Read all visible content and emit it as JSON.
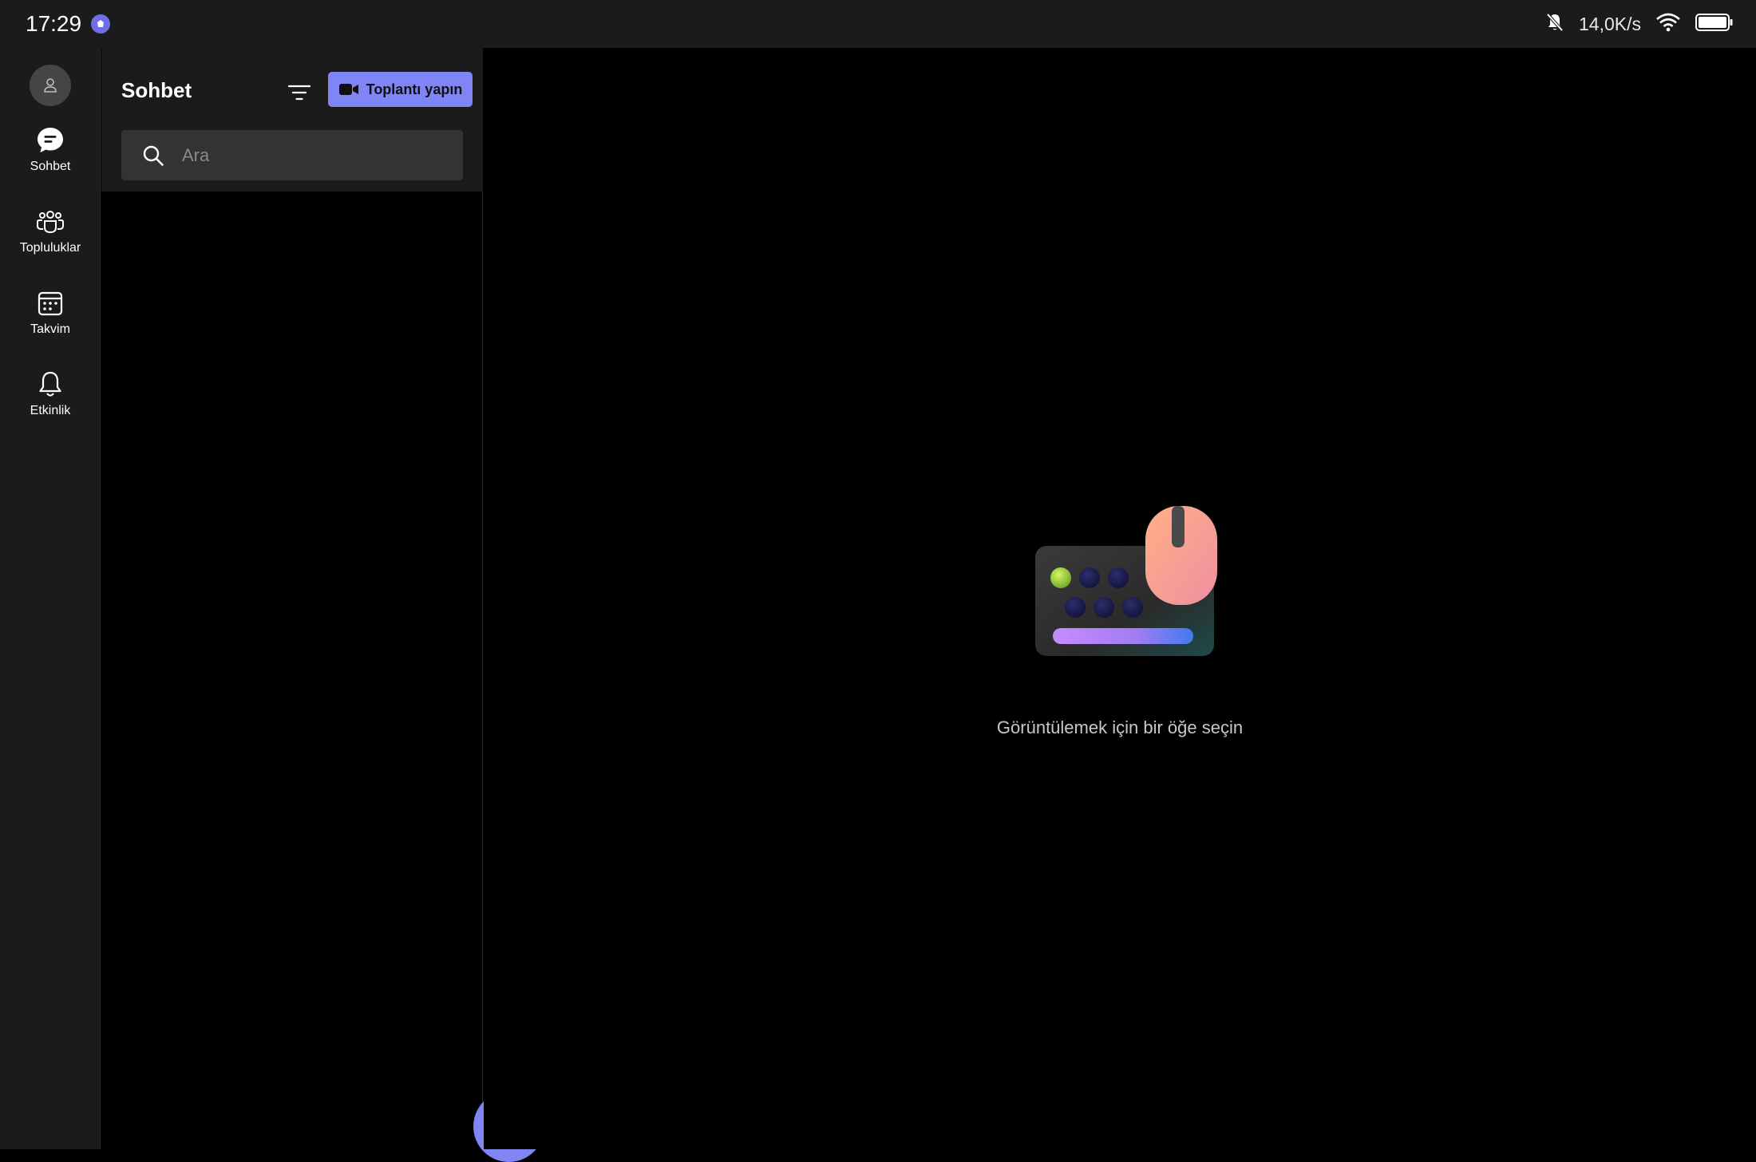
{
  "status_bar": {
    "time": "17:29",
    "network_speed": "14,0K/s",
    "icons": [
      "app-notification-icon",
      "bell-muted-icon",
      "wifi-icon",
      "battery-icon"
    ]
  },
  "nav_rail": {
    "items": [
      {
        "label": "Sohbet",
        "icon": "chat-icon"
      },
      {
        "label": "Topluluklar",
        "icon": "communities-icon"
      },
      {
        "label": "Takvim",
        "icon": "calendar-icon"
      },
      {
        "label": "Etkinlik",
        "icon": "bell-icon"
      }
    ]
  },
  "list_panel": {
    "title": "Sohbet",
    "meet_button_label": "Toplantı yapın",
    "search_placeholder": "Ara"
  },
  "main": {
    "empty_state_text": "Görüntülemek için bir öğe seçin"
  },
  "colors": {
    "accent": "#7f85f5",
    "surface": "#1b1b1b",
    "background": "#000000"
  }
}
